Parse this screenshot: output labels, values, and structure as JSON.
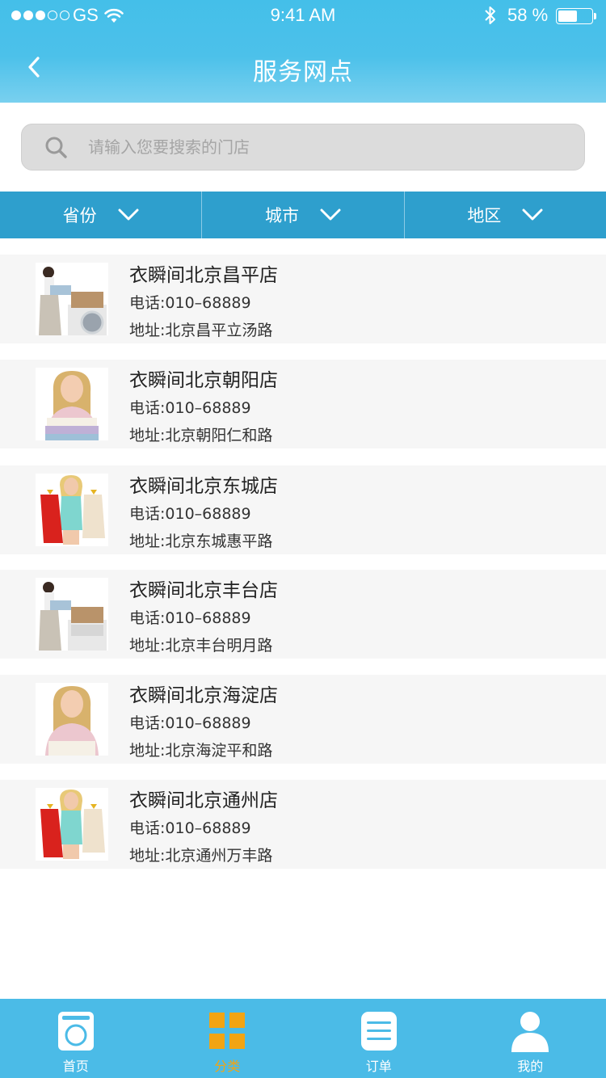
{
  "status_bar": {
    "carrier": "GS",
    "time": "9:41 AM",
    "battery": "58 %",
    "battery_level": 0.58
  },
  "nav": {
    "title": "服务网点"
  },
  "search": {
    "placeholder": "请输入您要搜索的门店"
  },
  "filters": [
    {
      "label": "省份"
    },
    {
      "label": "城市"
    },
    {
      "label": "地区"
    }
  ],
  "stores": [
    {
      "name": "衣瞬间北京昌平店",
      "phone": "电话:010–68889",
      "address": "地址:北京昌平立汤路",
      "image": "woman-with-laundry-basket"
    },
    {
      "name": "衣瞬间北京朝阳店",
      "phone": "电话:010–68889",
      "address": "地址:北京朝阳仁和路",
      "image": "woman-holding-folded-clothes"
    },
    {
      "name": "衣瞬间北京东城店",
      "phone": "电话:010–68889",
      "address": "地址:北京东城惠平路",
      "image": "woman-with-dresses"
    },
    {
      "name": "衣瞬间北京丰台店",
      "phone": "电话:010–68889",
      "address": "地址:北京丰台明月路",
      "image": "woman-with-laundry-basket"
    },
    {
      "name": "衣瞬间北京海淀店",
      "phone": "电话:010–68889",
      "address": "地址:北京海淀平和路",
      "image": "woman-holding-folded-clothes"
    },
    {
      "name": "衣瞬间北京通州店",
      "phone": "电话:010–68889",
      "address": "地址:北京通州万丰路",
      "image": "woman-with-dresses"
    }
  ],
  "tabs": [
    {
      "label": "首页",
      "icon": "washing-machine-icon",
      "active": false
    },
    {
      "label": "分类",
      "icon": "category-grid-icon",
      "active": true
    },
    {
      "label": "订单",
      "icon": "order-list-icon",
      "active": false
    },
    {
      "label": "我的",
      "icon": "user-icon",
      "active": false
    }
  ],
  "colors": {
    "header": "#4cc1ea",
    "filter_bar": "#2e9fcd",
    "tab_bar": "#4bbbe7",
    "active_tab": "#f2a413"
  }
}
